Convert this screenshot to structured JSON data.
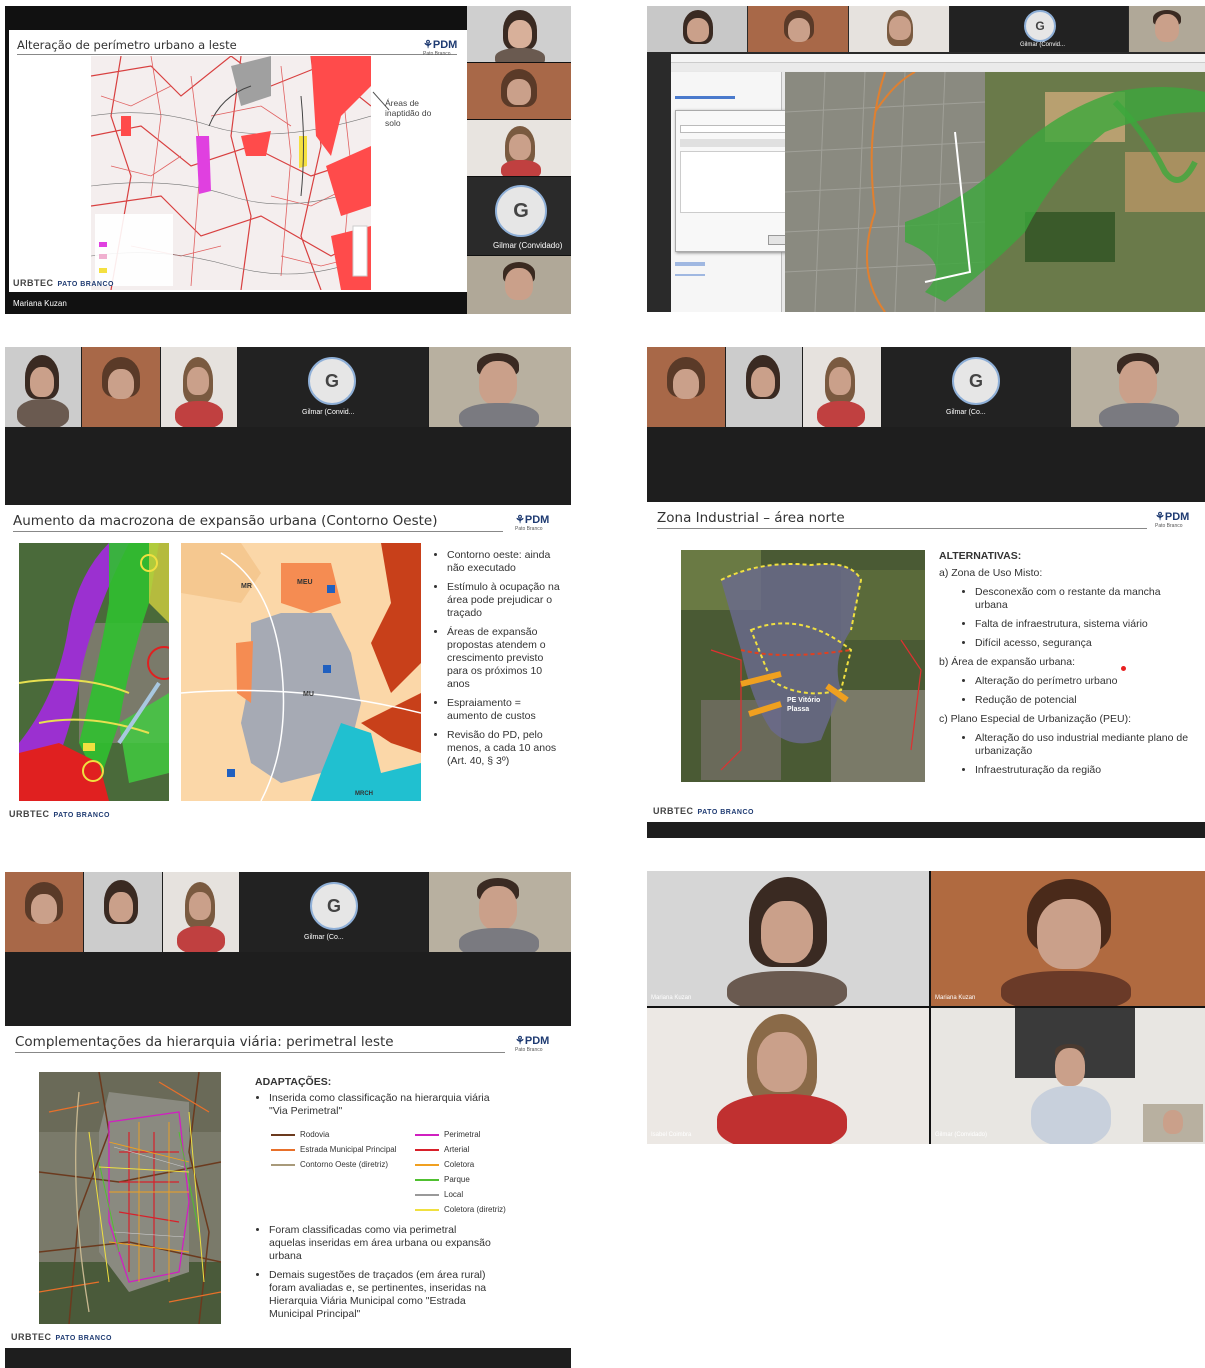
{
  "panel1": {
    "slide_title": "Alteração de perímetro urbano a leste",
    "logo_text": "PDM",
    "logo_sub": "Pato Branco",
    "map_annotation": "Áreas de inaptidão do solo",
    "footer_brand": "URBTEC",
    "footer_city": "PATO BRANCO",
    "presenter_name": "Mariana Kuzan",
    "guest_initial": "G",
    "guest_name": "Gilmar (Convidado)"
  },
  "panel2": {
    "guest_initial": "G",
    "guest_name": "Gilmar (Convid..."
  },
  "panel3": {
    "guest_initial": "G",
    "guest_name": "Gilmar (Convid...",
    "slide_title": "Aumento da macrozona de expansão urbana (Contorno Oeste)",
    "logo_text": "PDM",
    "logo_sub": "Pato Branco",
    "zone_labels": [
      "MR",
      "MEU",
      "MU",
      "MRCH"
    ],
    "bullets": [
      "Contorno oeste: ainda não executado",
      "Estímulo à ocupação na área pode prejudicar o traçado",
      "Áreas de expansão propostas atendem o crescimento previsto para os próximos 10 anos",
      "Espraiamento = aumento de custos",
      "Revisão do PD, pelo menos, a cada 10 anos (Art. 40, § 3º)"
    ],
    "footer_brand": "URBTEC",
    "footer_city": "PATO BRANCO"
  },
  "panel4": {
    "guest_initial": "G",
    "guest_name": "Gilmar (Co...",
    "slide_title": "Zona Industrial – área norte",
    "logo_text": "PDM",
    "logo_sub": "Pato Branco",
    "map_label": "PE Vitório Plassa",
    "heading": "ALTERNATIVAS:",
    "a_label": "a) Zona de Uso Misto:",
    "a_items": [
      "Desconexão com o restante da mancha urbana",
      "Falta de infraestrutura, sistema viário",
      "Difícil acesso, segurança"
    ],
    "b_label": "b) Área de expansão urbana:",
    "b_items": [
      "Alteração do perímetro urbano",
      "Redução de potencial"
    ],
    "c_label": "c) Plano Especial de Urbanização (PEU):",
    "c_items": [
      "Alteração do uso industrial mediante plano de urbanização",
      "Infraestruturação da região"
    ],
    "footer_brand": "URBTEC",
    "footer_city": "PATO BRANCO"
  },
  "panel5": {
    "guest_initial": "G",
    "guest_name": "Gilmar (Co...",
    "slide_title": "Complementações da hierarquia viária: perimetral leste",
    "logo_text": "PDM",
    "logo_sub": "Pato Branco",
    "heading": "ADAPTAÇÕES:",
    "bullet1": "Inserida como classificação na hierarquia viária \"Via Perimetral\"",
    "legend_left": [
      {
        "label": "Rodovia",
        "color": "#6b3a1e"
      },
      {
        "label": "Estrada Municipal Principal",
        "color": "#e8702a"
      },
      {
        "label": "Contorno Oeste (diretriz)",
        "color": "#a89a7a"
      }
    ],
    "legend_right": [
      {
        "label": "Perimetral",
        "color": "#d020c0"
      },
      {
        "label": "Arterial",
        "color": "#d8202a"
      },
      {
        "label": "Coletora",
        "color": "#f0a020"
      },
      {
        "label": "Parque",
        "color": "#50c030"
      },
      {
        "label": "Local",
        "color": "#999999"
      },
      {
        "label": "Coletora (diretriz)",
        "color": "#f0e040"
      }
    ],
    "bullet2": "Foram classificadas como via perimetral aquelas inseridas em área urbana ou expansão urbana",
    "bullet3": "Demais sugestões de traçados (em área rural) foram avaliadas e, se pertinentes, inseridas na Hierarquia Viária Municipal como \"Estrada Municipal Principal\"",
    "footer_brand": "URBTEC",
    "footer_city": "PATO BRANCO"
  },
  "panel6": {
    "names": [
      "Mariana Kuzan",
      "Mariana Kuzan",
      "Isabel Coimbra",
      "Gilmar (Convidado)"
    ]
  }
}
